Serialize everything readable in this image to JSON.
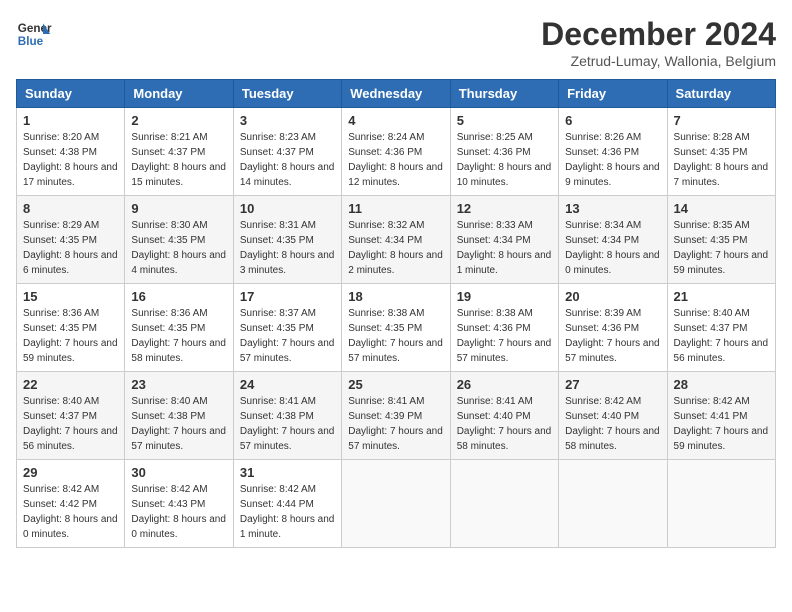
{
  "logo": {
    "line1": "General",
    "line2": "Blue"
  },
  "title": "December 2024",
  "subtitle": "Zetrud-Lumay, Wallonia, Belgium",
  "days_header": [
    "Sunday",
    "Monday",
    "Tuesday",
    "Wednesday",
    "Thursday",
    "Friday",
    "Saturday"
  ],
  "weeks": [
    [
      {
        "day": "1",
        "sunrise": "8:20 AM",
        "sunset": "4:38 PM",
        "daylight": "8 hours and 17 minutes."
      },
      {
        "day": "2",
        "sunrise": "8:21 AM",
        "sunset": "4:37 PM",
        "daylight": "8 hours and 15 minutes."
      },
      {
        "day": "3",
        "sunrise": "8:23 AM",
        "sunset": "4:37 PM",
        "daylight": "8 hours and 14 minutes."
      },
      {
        "day": "4",
        "sunrise": "8:24 AM",
        "sunset": "4:36 PM",
        "daylight": "8 hours and 12 minutes."
      },
      {
        "day": "5",
        "sunrise": "8:25 AM",
        "sunset": "4:36 PM",
        "daylight": "8 hours and 10 minutes."
      },
      {
        "day": "6",
        "sunrise": "8:26 AM",
        "sunset": "4:36 PM",
        "daylight": "8 hours and 9 minutes."
      },
      {
        "day": "7",
        "sunrise": "8:28 AM",
        "sunset": "4:35 PM",
        "daylight": "8 hours and 7 minutes."
      }
    ],
    [
      {
        "day": "8",
        "sunrise": "8:29 AM",
        "sunset": "4:35 PM",
        "daylight": "8 hours and 6 minutes."
      },
      {
        "day": "9",
        "sunrise": "8:30 AM",
        "sunset": "4:35 PM",
        "daylight": "8 hours and 4 minutes."
      },
      {
        "day": "10",
        "sunrise": "8:31 AM",
        "sunset": "4:35 PM",
        "daylight": "8 hours and 3 minutes."
      },
      {
        "day": "11",
        "sunrise": "8:32 AM",
        "sunset": "4:34 PM",
        "daylight": "8 hours and 2 minutes."
      },
      {
        "day": "12",
        "sunrise": "8:33 AM",
        "sunset": "4:34 PM",
        "daylight": "8 hours and 1 minute."
      },
      {
        "day": "13",
        "sunrise": "8:34 AM",
        "sunset": "4:34 PM",
        "daylight": "8 hours and 0 minutes."
      },
      {
        "day": "14",
        "sunrise": "8:35 AM",
        "sunset": "4:35 PM",
        "daylight": "7 hours and 59 minutes."
      }
    ],
    [
      {
        "day": "15",
        "sunrise": "8:36 AM",
        "sunset": "4:35 PM",
        "daylight": "7 hours and 59 minutes."
      },
      {
        "day": "16",
        "sunrise": "8:36 AM",
        "sunset": "4:35 PM",
        "daylight": "7 hours and 58 minutes."
      },
      {
        "day": "17",
        "sunrise": "8:37 AM",
        "sunset": "4:35 PM",
        "daylight": "7 hours and 57 minutes."
      },
      {
        "day": "18",
        "sunrise": "8:38 AM",
        "sunset": "4:35 PM",
        "daylight": "7 hours and 57 minutes."
      },
      {
        "day": "19",
        "sunrise": "8:38 AM",
        "sunset": "4:36 PM",
        "daylight": "7 hours and 57 minutes."
      },
      {
        "day": "20",
        "sunrise": "8:39 AM",
        "sunset": "4:36 PM",
        "daylight": "7 hours and 57 minutes."
      },
      {
        "day": "21",
        "sunrise": "8:40 AM",
        "sunset": "4:37 PM",
        "daylight": "7 hours and 56 minutes."
      }
    ],
    [
      {
        "day": "22",
        "sunrise": "8:40 AM",
        "sunset": "4:37 PM",
        "daylight": "7 hours and 56 minutes."
      },
      {
        "day": "23",
        "sunrise": "8:40 AM",
        "sunset": "4:38 PM",
        "daylight": "7 hours and 57 minutes."
      },
      {
        "day": "24",
        "sunrise": "8:41 AM",
        "sunset": "4:38 PM",
        "daylight": "7 hours and 57 minutes."
      },
      {
        "day": "25",
        "sunrise": "8:41 AM",
        "sunset": "4:39 PM",
        "daylight": "7 hours and 57 minutes."
      },
      {
        "day": "26",
        "sunrise": "8:41 AM",
        "sunset": "4:40 PM",
        "daylight": "7 hours and 58 minutes."
      },
      {
        "day": "27",
        "sunrise": "8:42 AM",
        "sunset": "4:40 PM",
        "daylight": "7 hours and 58 minutes."
      },
      {
        "day": "28",
        "sunrise": "8:42 AM",
        "sunset": "4:41 PM",
        "daylight": "7 hours and 59 minutes."
      }
    ],
    [
      {
        "day": "29",
        "sunrise": "8:42 AM",
        "sunset": "4:42 PM",
        "daylight": "8 hours and 0 minutes."
      },
      {
        "day": "30",
        "sunrise": "8:42 AM",
        "sunset": "4:43 PM",
        "daylight": "8 hours and 0 minutes."
      },
      {
        "day": "31",
        "sunrise": "8:42 AM",
        "sunset": "4:44 PM",
        "daylight": "8 hours and 1 minute."
      },
      null,
      null,
      null,
      null
    ]
  ]
}
